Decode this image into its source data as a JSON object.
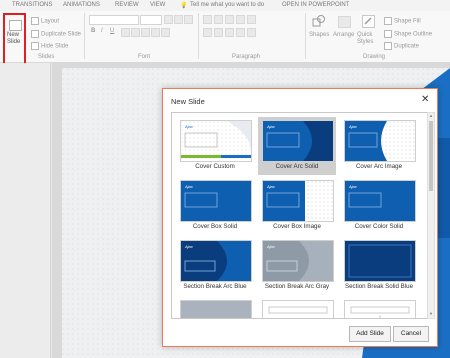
{
  "tabs": [
    "TRANSITIONS",
    "ANIMATIONS",
    "REVIEW",
    "VIEW",
    "Tell me what you want to do",
    "OPEN IN POWERPOINT"
  ],
  "ribbon": {
    "new_slide": "New\nSlide",
    "layout": "Layout",
    "duplicate_slide": "Duplicate Slide",
    "hide_slide": "Hide Slide",
    "group_slides": "Slides",
    "group_font": "Font",
    "group_paragraph": "Paragraph",
    "group_drawing": "Drawing",
    "shapes": "Shapes",
    "arrange": "Arrange",
    "quick_styles": "Quick Styles",
    "shape_fill": "Shape Fill",
    "shape_outline": "Shape Outline",
    "duplicate": "Duplicate",
    "bold": "B",
    "italic": "I",
    "underline": "U"
  },
  "dialog": {
    "title": "New Slide",
    "close": "✕",
    "add_button": "Add Slide",
    "cancel_button": "Cancel",
    "layouts": [
      {
        "name": "Cover Custom",
        "selected": false
      },
      {
        "name": "Cover Arc Solid",
        "selected": true
      },
      {
        "name": "Cover Arc Image",
        "selected": false
      },
      {
        "name": "Cover Box Solid",
        "selected": false
      },
      {
        "name": "Cover Box Image",
        "selected": false
      },
      {
        "name": "Cover Color Solid",
        "selected": false
      },
      {
        "name": "Section Break Arc Blue",
        "selected": false
      },
      {
        "name": "Section Break Arc Gray",
        "selected": false
      },
      {
        "name": "Section Break Solid Blue",
        "selected": false
      }
    ],
    "thumb_logo": "Ajax"
  },
  "colors": {
    "blue": "#0f5fb0",
    "dark_blue": "#0a3d7e",
    "gray": "#8e9aa6",
    "accent_green": "#7cb82f",
    "red_highlight": "#e02020"
  }
}
